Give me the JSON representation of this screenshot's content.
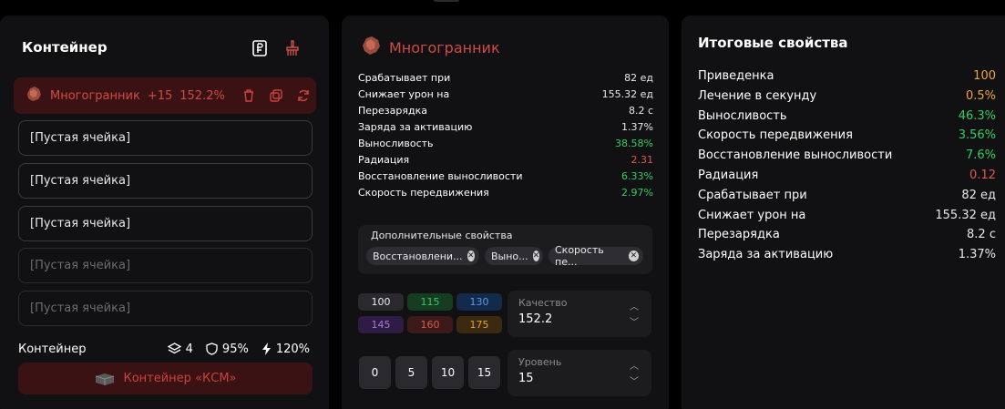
{
  "left_panel": {
    "title": "Контейнер",
    "icons": [
      "ruble-doc-icon",
      "broom-icon"
    ],
    "selected_slot": {
      "name": "Многогранник",
      "level": "+15",
      "percent": "152.2%",
      "actions": [
        "trash-icon",
        "copy-icon",
        "refresh-icon"
      ]
    },
    "slots": [
      {
        "label": "[Пустая ячейка]",
        "dim": false
      },
      {
        "label": "[Пустая ячейка]",
        "dim": false
      },
      {
        "label": "[Пустая ячейка]",
        "dim": false
      },
      {
        "label": "[Пустая ячейка]",
        "dim": true
      },
      {
        "label": "[Пустая ячейка]",
        "dim": true
      }
    ],
    "footer": {
      "label": "Контейнер",
      "slots_count": "4",
      "protection": "95%",
      "energy": "120%"
    },
    "container_button": "Контейнер «КСМ»"
  },
  "middle_panel": {
    "artifact_name": "Многогранник",
    "properties": [
      {
        "name": "Срабатывает при",
        "value": "82 ед",
        "color": "default"
      },
      {
        "name": "Снижает урон на",
        "value": "155.32 ед",
        "color": "default"
      },
      {
        "name": "Перезарядка",
        "value": "8.2 с",
        "color": "default"
      },
      {
        "name": "Заряда за активацию",
        "value": "1.37%",
        "color": "default"
      },
      {
        "name": "Выносливость",
        "value": "38.58%",
        "color": "green"
      },
      {
        "name": "Радиация",
        "value": "2.31",
        "color": "red"
      },
      {
        "name": "Восстановление выносливости",
        "value": "6.33%",
        "color": "green"
      },
      {
        "name": "Скорость передвижения",
        "value": "2.97%",
        "color": "green"
      }
    ],
    "extra": {
      "title": "Дополнительные свойства",
      "chips": [
        "Восстановлени...",
        "Выно...",
        "Скорость пе..."
      ]
    },
    "quality_buttons": [
      {
        "label": "100",
        "bg": "#2a2a2e",
        "fg": "#e8e8e8"
      },
      {
        "label": "115",
        "bg": "#153d22",
        "fg": "#39c56a"
      },
      {
        "label": "130",
        "bg": "#142a4a",
        "fg": "#5a9be8"
      },
      {
        "label": "145",
        "bg": "#2f1c44",
        "fg": "#a77ad6"
      },
      {
        "label": "160",
        "bg": "#3d1a1a",
        "fg": "#d65a52"
      },
      {
        "label": "175",
        "bg": "#3b2a10",
        "fg": "#e0a23a"
      }
    ],
    "quality": {
      "label": "Качество",
      "value": "152.2"
    },
    "level_buttons": [
      "0",
      "5",
      "10",
      "15"
    ],
    "level": {
      "label": "Уровень",
      "value": "15"
    }
  },
  "right_panel": {
    "title": "Итоговые свойства",
    "properties": [
      {
        "name": "Приведенка",
        "value": "100",
        "color": "orange"
      },
      {
        "name": "Лечение в секунду",
        "value": "0.5%",
        "color": "orange"
      },
      {
        "name": "Выносливость",
        "value": "46.3%",
        "color": "green"
      },
      {
        "name": "Скорость передвижения",
        "value": "3.56%",
        "color": "green"
      },
      {
        "name": "Восстановление выносливости",
        "value": "7.6%",
        "color": "green"
      },
      {
        "name": "Радиация",
        "value": "0.12",
        "color": "red"
      },
      {
        "name": "Срабатывает при",
        "value": "82 ед",
        "color": "default"
      },
      {
        "name": "Снижает урон на",
        "value": "155.32 ед",
        "color": "default"
      },
      {
        "name": "Перезарядка",
        "value": "8.2 с",
        "color": "default"
      },
      {
        "name": "Заряда за активацию",
        "value": "1.37%",
        "color": "default"
      }
    ]
  }
}
